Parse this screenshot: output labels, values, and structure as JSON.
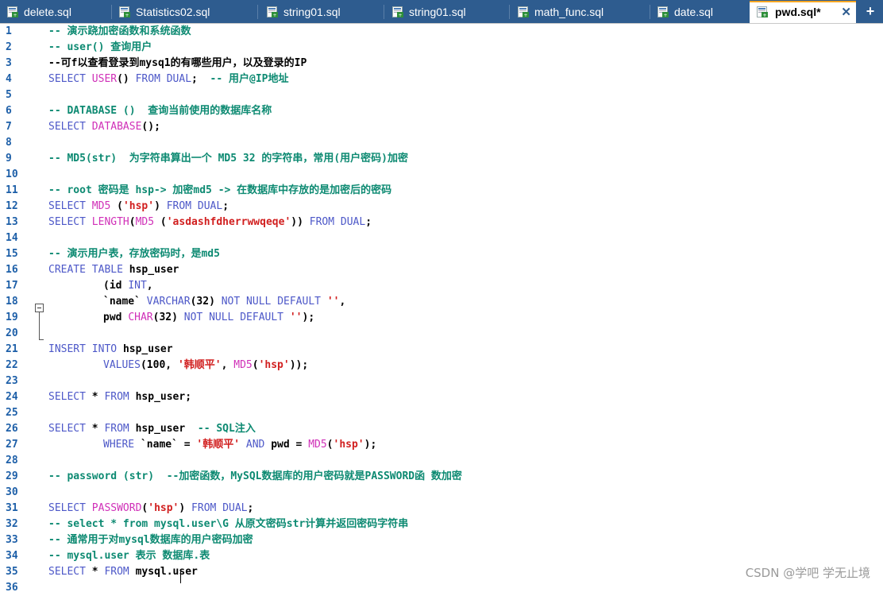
{
  "tabs": [
    {
      "label": "delete.sql"
    },
    {
      "label": "Statistics02.sql"
    },
    {
      "label": "string01.sql"
    },
    {
      "label": "string01.sql"
    },
    {
      "label": "math_func.sql"
    },
    {
      "label": "date.sql"
    },
    {
      "label": "pwd.sql*",
      "active": true
    }
  ],
  "tab_close_label": "✕",
  "add_tab_label": "+",
  "lines": [
    {
      "n": "1",
      "t": "-- 演示跷加密函数和系统函数"
    },
    {
      "n": "2",
      "t": "-- user() 查询用户"
    },
    {
      "n": "3",
      "t": "--可f以查看登录到mysq1的有哪些用户，以及登录的IP"
    },
    {
      "n": "4",
      "t": "SELECT USER() FROM DUAL;  -- 用户@IP地址"
    },
    {
      "n": "5",
      "t": ""
    },
    {
      "n": "6",
      "t": "-- DATABASE ()  查询当前使用的数据库名称"
    },
    {
      "n": "7",
      "t": "SELECT DATABASE();"
    },
    {
      "n": "8",
      "t": ""
    },
    {
      "n": "9",
      "t": "-- MD5(str)  为字符串算出一个 MD5 32 的字符串，常用(用户密码)加密"
    },
    {
      "n": "10",
      "t": ""
    },
    {
      "n": "11",
      "t": "-- root 密码是 hsp-> 加密md5 -> 在数据库中存放的是加密后的密码"
    },
    {
      "n": "12",
      "t": "SELECT MD5 ('hsp') FROM DUAL;"
    },
    {
      "n": "13",
      "t": "SELECT LENGTH(MD5 ('asdashfdherrwwqeqe')) FROM DUAL;"
    },
    {
      "n": "14",
      "t": ""
    },
    {
      "n": "15",
      "t": "-- 演示用户表，存放密码时，是md5"
    },
    {
      "n": "16",
      "t": "CREATE TABLE hsp_user"
    },
    {
      "n": "17",
      "t": "(id INT,"
    },
    {
      "n": "18",
      "t": "`name` VARCHAR(32) NOT NULL DEFAULT '',"
    },
    {
      "n": "19",
      "t": "pwd CHAR(32) NOT NULL DEFAULT '');"
    },
    {
      "n": "20",
      "t": ""
    },
    {
      "n": "21",
      "t": "INSERT INTO hsp_user"
    },
    {
      "n": "22",
      "t": "VALUES(100, '韩顺平', MD5('hsp'));"
    },
    {
      "n": "23",
      "t": ""
    },
    {
      "n": "24",
      "t": "SELECT * FROM hsp_user;"
    },
    {
      "n": "25",
      "t": ""
    },
    {
      "n": "26",
      "t": "SELECT * FROM hsp_user  -- SQL注入"
    },
    {
      "n": "27",
      "t": "WHERE `name` = '韩顺平' AND pwd = MD5('hsp');"
    },
    {
      "n": "28",
      "t": ""
    },
    {
      "n": "29",
      "t": "-- password (str)  --加密函数，MySQL数据库的用户密码就是PASSWORD函 数加密"
    },
    {
      "n": "30",
      "t": ""
    },
    {
      "n": "31",
      "t": "SELECT PASSWORD('hsp') FROM DUAL;"
    },
    {
      "n": "32",
      "t": "-- select * from mysql.user\\G 从原文密码str计算并返回密码字符串"
    },
    {
      "n": "33",
      "t": "-- 通常用于对mysql数据库的用户密码加密"
    },
    {
      "n": "34",
      "t": "-- mysql.user 表示 数据库.表"
    },
    {
      "n": "35",
      "t": "SELECT * FROM mysql.user"
    },
    {
      "n": "36",
      "t": ""
    }
  ],
  "watermark": "CSDN @学吧 学无止境",
  "colors": {
    "tab_bar": "#2e5c8f",
    "active_tab_accent": "#f5a623",
    "comment": "#0d8a72",
    "keyword": "#4d58c8",
    "function": "#d030b8",
    "string": "#d11f1f",
    "line_number": "#1d5fa8"
  }
}
